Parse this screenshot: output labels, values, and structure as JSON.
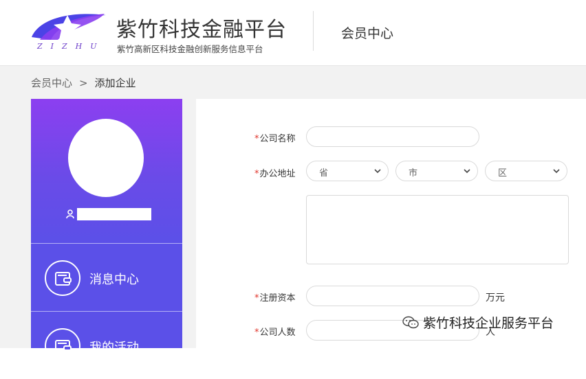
{
  "header": {
    "brand_title": "紫竹科技金融平台",
    "brand_subtitle": "紫竹高新区科技金融创新服务信息平台",
    "brand_letters": "ZIZHU",
    "section_title": "会员中心",
    "logo_colors": [
      "#3d46e0",
      "#8a3ff0"
    ]
  },
  "breadcrumb": {
    "parent": "会员中心",
    "separator": ">",
    "current": "添加企业"
  },
  "sidebar": {
    "avatar_icon": "user-avatar-placeholder",
    "user_icon": "user-icon",
    "items": [
      {
        "label": "消息中心",
        "icon": "wallet-icon"
      },
      {
        "label": "我的活动",
        "icon": "wallet-icon"
      }
    ],
    "colors": {
      "gradient_top": "#8c3ff0",
      "base": "#5b50e8"
    }
  },
  "form": {
    "required_mark": "*",
    "company_name": {
      "label": "公司名称",
      "value": ""
    },
    "address": {
      "label": "办公地址",
      "province_placeholder": "省",
      "city_placeholder": "市",
      "district_placeholder": "区",
      "detail_value": ""
    },
    "capital": {
      "label": "注册资本",
      "value": "",
      "unit": "万元"
    },
    "headcount": {
      "label": "公司人数",
      "value": "",
      "unit": "人"
    }
  },
  "watermark": {
    "text": "紫竹科技企业服务平台",
    "icon": "wechat-icon"
  },
  "colors": {
    "accent": "#5b50e8",
    "required": "#e0342b",
    "page_bg": "#f2f2f2"
  }
}
